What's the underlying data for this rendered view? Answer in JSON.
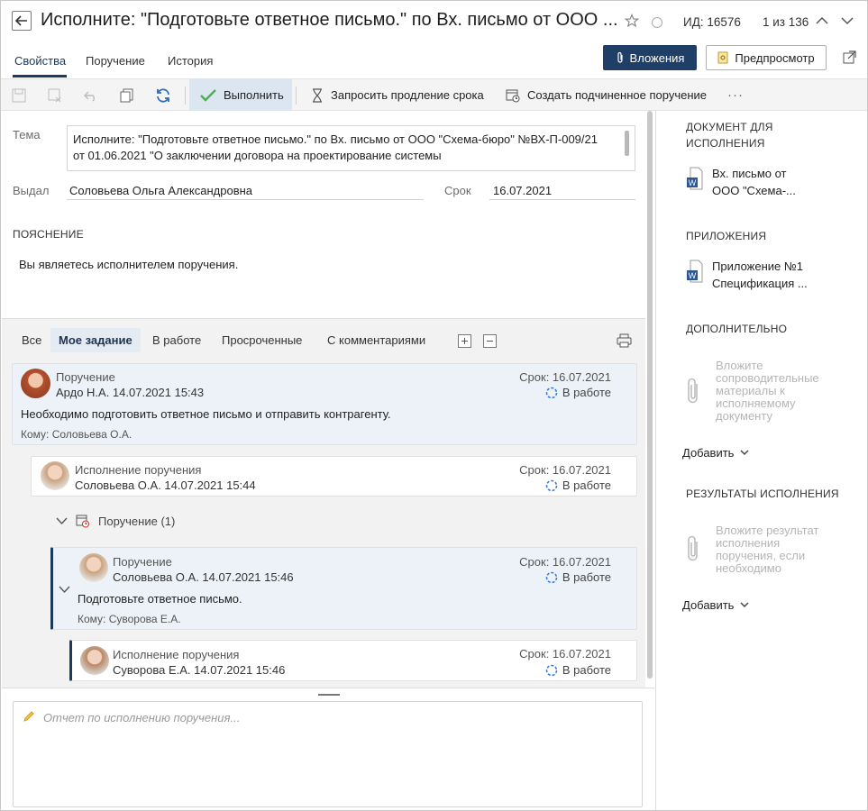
{
  "header": {
    "title": "Исполните: \"Подготовьте ответное письмо.\" по Вх. письмо от ООО ...",
    "id_label": "ИД: 16576",
    "counter": "1 из 136",
    "tabs": [
      "Свойства",
      "Поручение",
      "История"
    ],
    "attachments_button": "Вложения",
    "preview_button": "Предпросмотр"
  },
  "toolbar": {
    "execute": "Выполнить",
    "request_extension": "Запросить продление срока",
    "create_subtask": "Создать подчиненное поручение",
    "more": "···"
  },
  "form": {
    "topic_label": "Тема",
    "topic_value": "Исполните: \"Подготовьте ответное письмо.\" по Вх. письмо от ООО \"Схема-бюро\" №ВХ-П-009/21 от 01.06.2021 \"О заключении договора на проектирование системы",
    "issued_label": "Выдал",
    "issued_value": "Соловьева Ольга Александровна",
    "due_label": "Срок",
    "due_value": "16.07.2021",
    "note_header": "ПОЯСНЕНИЕ",
    "note_text": "Вы являетесь исполнителем поручения."
  },
  "filters": [
    "Все",
    "Мое задание",
    "В работе",
    "Просроченные",
    "С комментариями"
  ],
  "tasks": {
    "t1": {
      "type": "Поручение",
      "author": "Ардо Н.А.  14.07.2021 15:43",
      "due": "Срок: 16.07.2021",
      "status": "В работе",
      "body": "Необходимо подготовить ответное письмо и отправить контрагенту.",
      "to": "Кому: Соловьева О.А."
    },
    "t2": {
      "type": "Исполнение поручения",
      "author": "Соловьева О.А.  14.07.2021 15:44",
      "due": "Срок: 16.07.2021",
      "status": "В работе"
    },
    "group": "Поручение (1)",
    "t3": {
      "type": "Поручение",
      "author": "Соловьева О.А.  14.07.2021 15:46",
      "due": "Срок: 16.07.2021",
      "status": "В работе",
      "body": "Подготовьте ответное письмо.",
      "to": "Кому: Суворова Е.А."
    },
    "t4": {
      "type": "Исполнение поручения",
      "author": "Суворова Е.А.  14.07.2021 15:46",
      "due": "Срок: 16.07.2021",
      "status": "В работе"
    }
  },
  "comment_placeholder": "Отчет по исполнению поручения...",
  "sidebar": {
    "doc_header": "ДОКУМЕНТ ДЛЯ ИСПОЛНЕНИЯ",
    "doc_name": "Вх. письмо от ООО \"Схема-...",
    "attachments_header": "ПРИЛОЖЕНИЯ",
    "attachment_name": "Приложение №1 Спецификация ...",
    "extra_header": "ДОПОЛНИТЕЛЬНО",
    "extra_hint": "Вложите сопроводительные материалы к исполняемому документу",
    "add_label": "Добавить",
    "results_header": "РЕЗУЛЬТАТЫ ИСПОЛНЕНИЯ",
    "results_hint": "Вложите результат исполнения поручения, если необходимо",
    "add_label2": "Добавить"
  },
  "colors": {
    "accent": "#203f66",
    "highlight": "#dbe6f1",
    "check": "#4caf50",
    "word": "#2b5797"
  }
}
